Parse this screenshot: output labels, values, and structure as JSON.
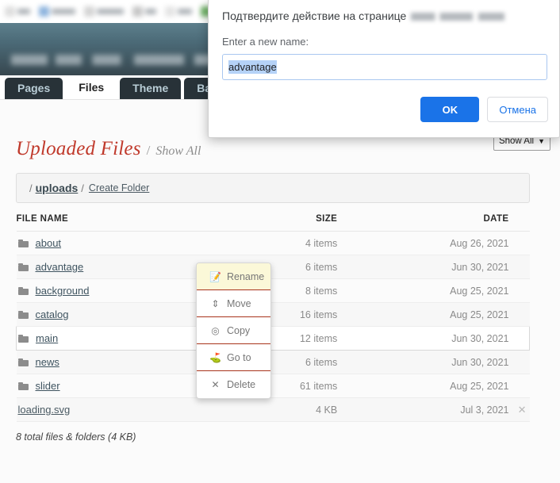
{
  "browser": {
    "bookmarks": [
      {
        "name": "bookmark-1",
        "color": "#d8d8d8",
        "width": 16
      },
      {
        "name": "bookmark-2",
        "color": "#7aa7d8",
        "width": 30
      },
      {
        "name": "bookmark-3",
        "color": "#cccccc",
        "width": 34
      },
      {
        "name": "bookmark-4",
        "color": "#bdbdbd",
        "width": 14
      },
      {
        "name": "bookmark-5",
        "color": "#e0e0e0",
        "width": 18
      },
      {
        "name": "bookmark-6",
        "color": "#5aa84f",
        "width": 30
      },
      {
        "name": "bookmark-7",
        "color": "#cfcfcf",
        "width": 30
      },
      {
        "name": "bookmark-8",
        "color": "#4e90c4",
        "width": 12
      },
      {
        "name": "bookmark-9",
        "color": "#e08b2a",
        "width": 10
      }
    ]
  },
  "dialog": {
    "title": "Подтвердите действие на странице",
    "label": "Enter a new name:",
    "input_value": "advantage",
    "input_placeholder": "",
    "ok_label": "OK",
    "cancel_label": "Отмена",
    "accent_color": "#1a73e8",
    "selection_color": "#b5d2f7"
  },
  "tabs": [
    {
      "label": "Pages",
      "active": false
    },
    {
      "label": "Files",
      "active": true
    },
    {
      "label": "Theme",
      "active": false
    },
    {
      "label": "Backup",
      "active": false
    }
  ],
  "page": {
    "title": "Uploaded Files",
    "title_separator": "/",
    "title_showall": "Show All",
    "title_color": "#c0392b",
    "filter_label": "Show All",
    "filter_caret": "▼"
  },
  "breadcrumb": {
    "leading_slash": "/",
    "root": "uploads",
    "mid_slash": "/",
    "create_folder": "Create Folder"
  },
  "table": {
    "columns": {
      "name": "FILE NAME",
      "size": "SIZE",
      "date": "DATE"
    },
    "rows": [
      {
        "name": "about",
        "type": "folder",
        "size": "4 items",
        "date": "Aug 26, 2021",
        "selected": false,
        "deletable": false
      },
      {
        "name": "advantage",
        "type": "folder",
        "size": "6 items",
        "date": "Jun 30, 2021",
        "selected": false,
        "deletable": false
      },
      {
        "name": "background",
        "type": "folder",
        "size": "8 items",
        "date": "Aug 25, 2021",
        "selected": false,
        "deletable": false
      },
      {
        "name": "catalog",
        "type": "folder",
        "size": "16 items",
        "date": "Aug 25, 2021",
        "selected": false,
        "deletable": false
      },
      {
        "name": "main",
        "type": "folder",
        "size": "12 items",
        "date": "Jun 30, 2021",
        "selected": true,
        "deletable": false
      },
      {
        "name": "news",
        "type": "folder",
        "size": "6 items",
        "date": "Jun 30, 2021",
        "selected": false,
        "deletable": false
      },
      {
        "name": "slider",
        "type": "folder",
        "size": "61 items",
        "date": "Aug 25, 2021",
        "selected": false,
        "deletable": false
      },
      {
        "name": "loading.svg",
        "type": "file",
        "size": "4 KB",
        "date": "Jul 3, 2021",
        "selected": false,
        "deletable": true
      }
    ],
    "delete_icon": "✕",
    "totals": "8 total files & folders (4 KB)"
  },
  "context_menu": {
    "items": [
      {
        "label": "Rename",
        "icon": "📝",
        "icon_name": "pencil-icon",
        "hover": true
      },
      {
        "label": "Move",
        "icon": "⇕",
        "icon_name": "move-icon",
        "hover": false
      },
      {
        "label": "Copy",
        "icon": "◎",
        "icon_name": "copy-icon",
        "hover": false
      },
      {
        "label": "Go to",
        "icon": "⛳",
        "icon_name": "golf-flag-icon",
        "hover": false
      },
      {
        "label": "Delete",
        "icon": "✕",
        "icon_name": "close-icon",
        "hover": false
      }
    ],
    "divider_color": "#a8341c",
    "hover_color": "#fbf8d8"
  }
}
